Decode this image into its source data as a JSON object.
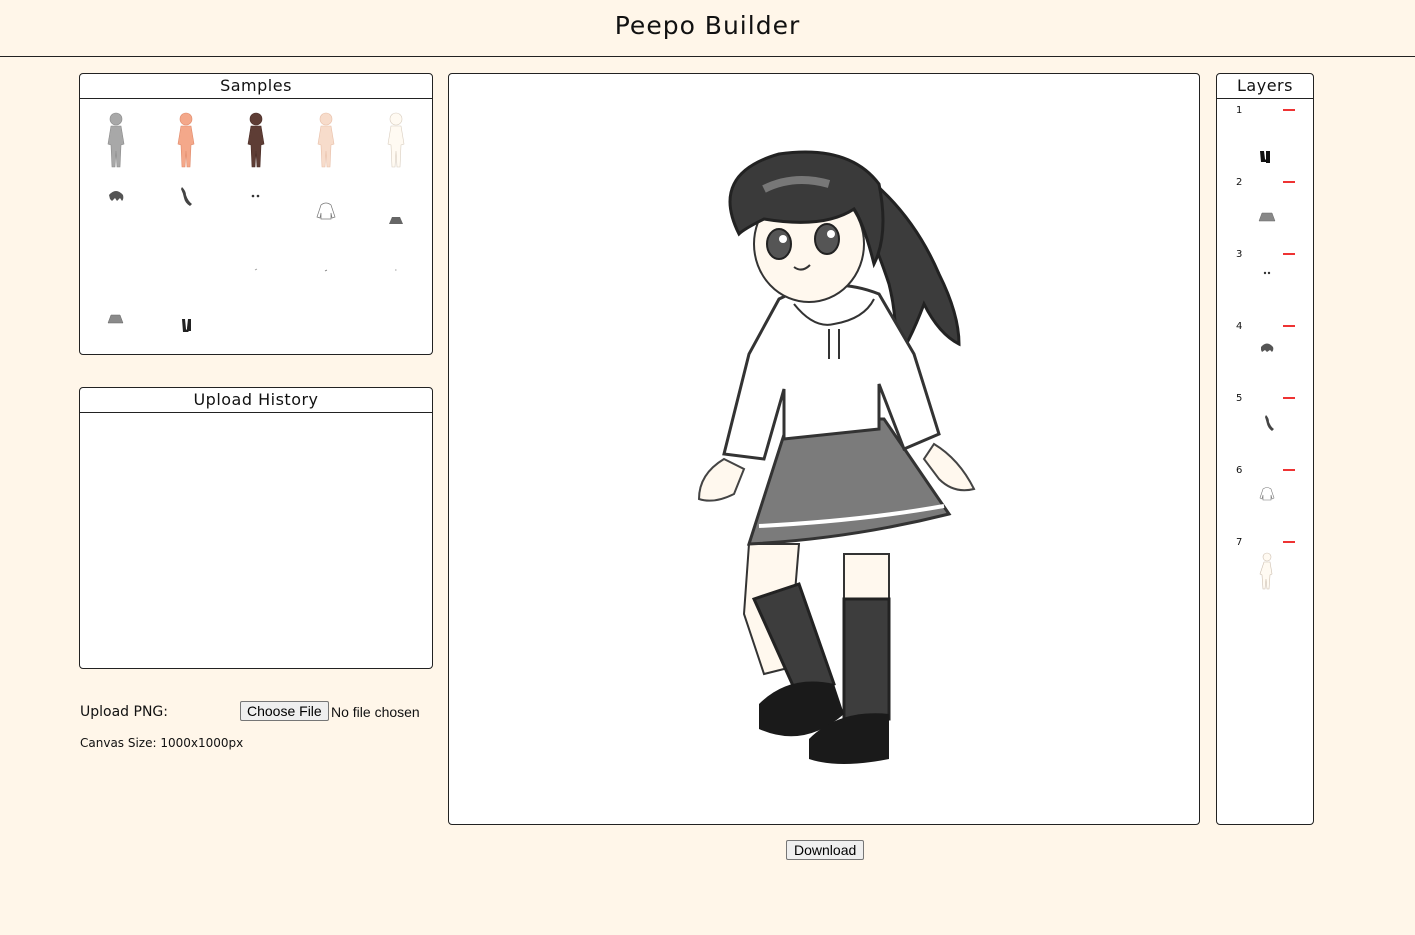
{
  "header": {
    "title": "Peepo Builder"
  },
  "samples": {
    "title": "Samples",
    "items": [
      {
        "name": "base-gray",
        "icon": "body-base-icon",
        "color": "#9a9a9a"
      },
      {
        "name": "base-peach",
        "icon": "body-base-icon",
        "color": "#f0a080"
      },
      {
        "name": "base-brown",
        "icon": "body-base-icon",
        "color": "#5a3a32"
      },
      {
        "name": "base-light",
        "icon": "body-base-icon",
        "color": "#f5d2bc"
      },
      {
        "name": "base-white",
        "icon": "body-base-icon",
        "color": "#fffaf0"
      },
      {
        "name": "hair-short",
        "icon": "hair-icon",
        "color": "#555555"
      },
      {
        "name": "hair-ponytail",
        "icon": "ponytail-icon",
        "color": "#444444"
      },
      {
        "name": "eyes",
        "icon": "eyes-icon",
        "color": "#333333"
      },
      {
        "name": "hoodie",
        "icon": "hoodie-icon",
        "color": "#888888"
      },
      {
        "name": "skirt-dark",
        "icon": "skirt-icon",
        "color": "#666666"
      },
      {
        "name": "mouth-1",
        "icon": "mouth-icon",
        "color": "#999999"
      },
      {
        "name": "mouth-2",
        "icon": "mouth-icon",
        "color": "#999999"
      },
      {
        "name": "mouth-3",
        "icon": "mouth-icon",
        "color": "#999999"
      },
      {
        "name": "skirt-gray",
        "icon": "skirt-icon",
        "color": "#8a8a8a"
      },
      {
        "name": "socks-shoes",
        "icon": "socks-icon",
        "color": "#222222"
      }
    ]
  },
  "history": {
    "title": "Upload History"
  },
  "upload": {
    "label": "Upload PNG:",
    "button": "Choose File",
    "status": "No file chosen",
    "canvas_size": "Canvas Size: 1000x1000px"
  },
  "download": {
    "label": "Download"
  },
  "layers": {
    "title": "Layers",
    "items": [
      {
        "num": "1",
        "icon": "socks-icon"
      },
      {
        "num": "2",
        "icon": "skirt-icon"
      },
      {
        "num": "3",
        "icon": "eyes-icon"
      },
      {
        "num": "4",
        "icon": "hair-icon"
      },
      {
        "num": "5",
        "icon": "ponytail-icon"
      },
      {
        "num": "6",
        "icon": "hoodie-icon"
      },
      {
        "num": "7",
        "icon": "body-base-icon"
      }
    ]
  }
}
